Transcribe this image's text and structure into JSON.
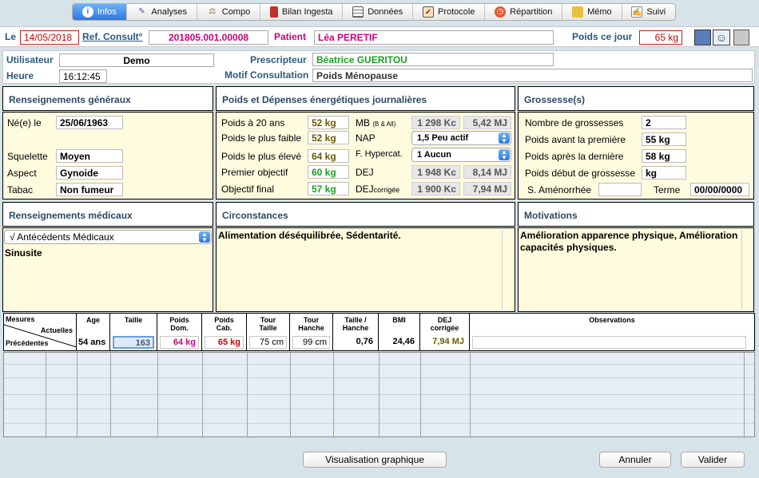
{
  "tabs": [
    {
      "label": "Infos",
      "icon": "info-icon",
      "active": true
    },
    {
      "label": "Analyses",
      "icon": "pen-icon",
      "active": false
    },
    {
      "label": "Compo",
      "icon": "scale-icon",
      "active": false
    },
    {
      "label": "Bilan Ingesta",
      "icon": "jar-icon",
      "active": false
    },
    {
      "label": "Données",
      "icon": "grid-icon",
      "active": false
    },
    {
      "label": "Protocole",
      "icon": "clipboard-icon",
      "active": false
    },
    {
      "label": "Répartition",
      "icon": "clock-icon",
      "active": false
    },
    {
      "label": "Mémo",
      "icon": "folder-icon",
      "active": false
    },
    {
      "label": "Suivi",
      "icon": "notepad-icon",
      "active": false
    }
  ],
  "header": {
    "le_label": "Le",
    "date": "14/05/2018",
    "ref_label": "Ref. Consult°",
    "ref_value": "201805.001.00008",
    "patient_label": "Patient",
    "patient_value": "Léa PERETIF",
    "poids_label": "Poids ce jour",
    "poids_value": "65 kg"
  },
  "info": {
    "utilisateur_label": "Utilisateur",
    "utilisateur_value": "Demo",
    "heure_label": "Heure",
    "heure_value": "16:12:45",
    "prescripteur_label": "Prescripteur",
    "prescripteur_value": "Béatrice GUERITOU",
    "motif_label": "Motif Consultation",
    "motif_value": "Poids Ménopause"
  },
  "general": {
    "title": "Renseignements généraux",
    "ne_label": "Né(e) le",
    "ne_value": "25/06/1963",
    "squelette_label": "Squelette",
    "squelette_value": "Moyen",
    "aspect_label": "Aspect",
    "aspect_value": "Gynoide",
    "tabac_label": "Tabac",
    "tabac_value": "Non fumeur"
  },
  "poids": {
    "title": "Poids et Dépenses énergétiques journalières",
    "p20_label": "Poids à 20 ans",
    "p20_value": "52 kg",
    "pfaible_label": "Poids le plus  faible",
    "pfaible_value": "52 kg",
    "peleve_label": "Poids le plus élevé",
    "peleve_value": "64 kg",
    "obj1_label": "Premier objectif",
    "obj1_value": "60 kg",
    "objf_label": "Objectif final",
    "objf_value": "57 kg",
    "mb_label": "MB",
    "mb_sub": "(B & All)",
    "mb_kc": "1 298 Kc",
    "mb_mj": "5,42 MJ",
    "nap_label": "NAP",
    "nap_value": "1,5 Peu actif",
    "fhyp_label": "F. Hypercat.",
    "fhyp_value": "1 Aucun",
    "dej_label": "DEJ",
    "dej_kc": "1 948 Kc",
    "dej_mj": "8,14 MJ",
    "dejc_label": "DEJ",
    "dejc_sub": "corrigée",
    "dejc_kc": "1 900 Kc",
    "dejc_mj": "7,94 MJ"
  },
  "grossesse": {
    "title": "Grossesse(s)",
    "nb_label": "Nombre de grossesses",
    "nb_value": "2",
    "avant_label": "Poids avant la première",
    "avant_value": "55 kg",
    "apres_label": "Poids après la dernière",
    "apres_value": "58 kg",
    "debut_label": "Poids début de grossesse",
    "debut_value": "kg",
    "amen_label": "S. Aménorrhée",
    "amen_value": "",
    "terme_label": "Terme",
    "terme_value": "00/00/0000"
  },
  "medical": {
    "title": "Renseignements médicaux",
    "dropdown": "√ Antécédents Médicaux",
    "text": "Sinusite"
  },
  "circonstances": {
    "title": "Circonstances",
    "text": "Alimentation déséquilibrée, Sédentarité."
  },
  "motivations": {
    "title": "Motivations",
    "text": "Amélioration apparence physique, Amélioration capacités physiques."
  },
  "measures": {
    "mesures_label": "Mesures",
    "actuelles_label": "Actuelles",
    "precedentes_label": "Précédentes",
    "headers": [
      "Age",
      "Taille",
      "Poids Dom.",
      "Poids Cab.",
      "Tour Taille",
      "Tour Hanche",
      "Taille / Hanche",
      "BMI",
      "DEJ corrigée",
      "Observations"
    ],
    "values": [
      "54 ans",
      "163",
      "64 kg",
      "65 kg",
      "75 cm",
      "99 cm",
      "0,76",
      "24,46",
      "7,94 MJ",
      ""
    ]
  },
  "buttons": {
    "graph": "Visualisation graphique",
    "cancel": "Annuler",
    "ok": "Valider"
  }
}
